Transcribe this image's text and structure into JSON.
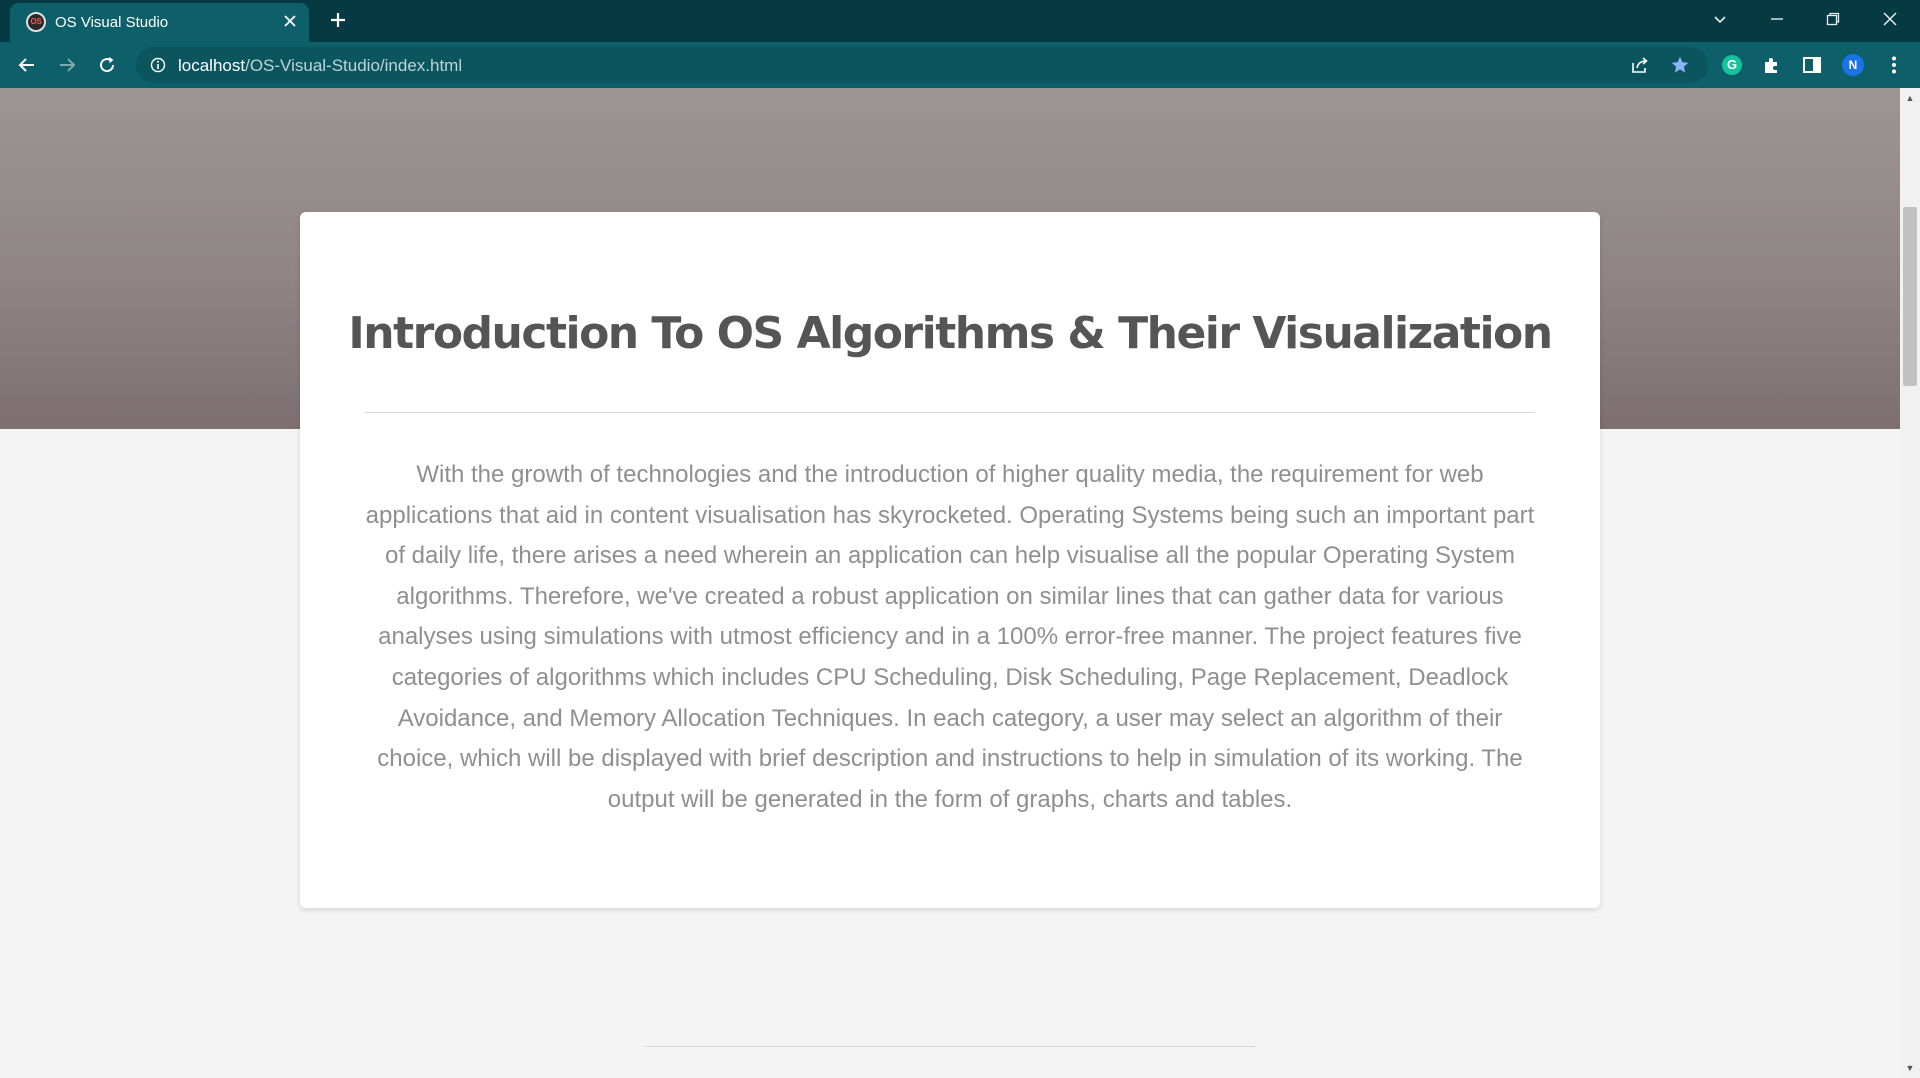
{
  "browser": {
    "tab": {
      "favicon_text": "OS",
      "title": "OS Visual Studio",
      "close_glyph": "✕"
    },
    "new_tab_glyph": "+",
    "address": {
      "host": "localhost",
      "path": "/OS-Visual-Studio/index.html"
    },
    "profile_initial": "N",
    "grammarly_initial": "G",
    "icons": {
      "back": "arrow-left-icon",
      "forward": "arrow-right-icon",
      "reload": "reload-icon",
      "site_info": "info-icon",
      "share": "share-icon",
      "bookmark": "star-icon",
      "extensions": "puzzle-icon",
      "side_panel": "side-panel-icon",
      "menu": "kebab-menu-icon",
      "tab_search": "chevron-down-icon",
      "minimize": "minimize-icon",
      "restore": "restore-icon",
      "close_window": "close-icon"
    },
    "colors": {
      "tab_strip": "#063a42",
      "toolbar": "#0d6069",
      "bookmark_star": "#8ab4f8",
      "grammarly": "#15c39a",
      "avatar": "#1a73e8"
    }
  },
  "page": {
    "heading": "Introduction To OS Algorithms & Their Visualization",
    "paragraph": "With the growth of technologies and the introduction of higher quality media, the requirement for web applications that aid in content visualisation has skyrocketed. Operating Systems being such an important part of daily life, there arises a need wherein an application can help visualise all the popular Operating System algorithms. Therefore, we've created a robust application on similar lines that can gather data for various analyses using simulations with utmost efficiency and in a 100% error-free manner. The project features five categories of algorithms which includes CPU Scheduling, Disk Scheduling, Page Replacement, Deadlock Avoidance, and Memory Allocation Techniques. In each category, a user may select an algorithm of their choice, which will be displayed with brief description and instructions to help in simulation of its working. The output will be generated in the form of graphs, charts and tables.",
    "colors": {
      "heading": "#555555",
      "paragraph": "#8f8f8f",
      "background": "#f4f4f4"
    }
  },
  "scrollbar": {
    "up_glyph": "▲",
    "down_glyph": "▼"
  }
}
